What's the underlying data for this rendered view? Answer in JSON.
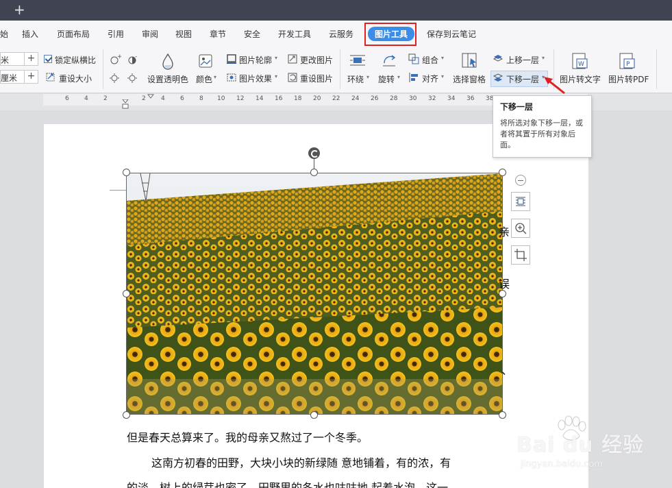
{
  "menu": {
    "tabs": [
      "始",
      "插入",
      "页面布局",
      "引用",
      "审阅",
      "视图",
      "章节",
      "安全",
      "开发工具",
      "云服务",
      "图片工具",
      "保存到云笔记"
    ],
    "active_tab": "图片工具"
  },
  "ribbon": {
    "size_inputs": [
      {
        "value": "米"
      },
      {
        "value": "厘米"
      }
    ],
    "lock_ratio": {
      "label": "锁定纵横比",
      "checked": true
    },
    "reset_size": "重设大小",
    "set_transparent": "设置透明色",
    "color": "颜色",
    "picture_outline": "图片轮廓",
    "picture_effect": "图片效果",
    "change_picture": "更改图片",
    "reset_picture": "重设图片",
    "wrap": "环绕",
    "rotate": "旋转",
    "group": "组合",
    "align": "对齐",
    "selection_pane": "选择窗格",
    "bring_forward": "上移一层",
    "send_backward": "下移一层",
    "picture_to_text": "图片转文字",
    "picture_to_pdf": "图片转PDF"
  },
  "ruler": {
    "numbers": [
      "6",
      "4",
      "2",
      "2",
      "4",
      "6",
      "8",
      "10",
      "12",
      "14",
      "16",
      "18",
      "20",
      "22",
      "24",
      "26",
      "28",
      "30",
      "32",
      "34",
      "36",
      "38"
    ]
  },
  "tooltip": {
    "title": "下移一层",
    "body": "将所选对象下移一层，或者将其置于所有对象后面。"
  },
  "document": {
    "line1": "但是春天总算来了。我的母亲又熬过了一个冬季。",
    "line2": "这南方初春的田野，大块小块的新绿随  意地铺着，有的浓，有",
    "line3": "的淡，树上的绿芽也密了，田野里的冬水也咕咕地  起着水泡。这一",
    "side_fragments": [
      "亲",
      "误",
      "、"
    ]
  },
  "watermark": {
    "brand": "Bai du 经验",
    "url": "jingyan.baidu.com"
  },
  "colors": {
    "titlebar": "#3f4352",
    "active_tab": "#3b8ee8",
    "highlight_box": "#e02020",
    "arrow": "#e02020"
  }
}
